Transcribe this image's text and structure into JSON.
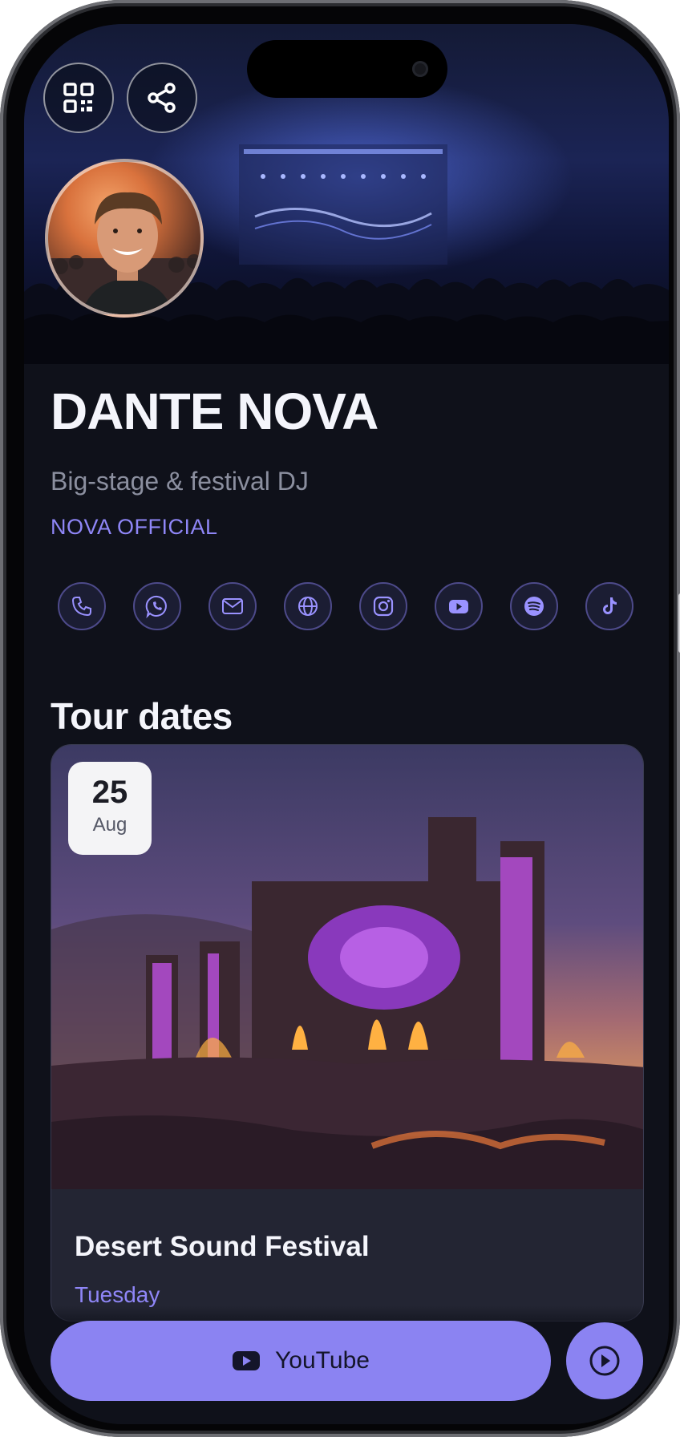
{
  "profile": {
    "name": "DANTE NOVA",
    "tagline": "Big-stage & festival DJ",
    "brand": "NOVA OFFICIAL"
  },
  "header": {
    "qr_icon": "qr-code-icon",
    "share_icon": "share-icon"
  },
  "socials": [
    "phone-icon",
    "whatsapp-icon",
    "mail-icon",
    "globe-icon",
    "instagram-icon",
    "youtube-icon",
    "spotify-icon",
    "tiktok-icon"
  ],
  "tour": {
    "title": "Tour dates",
    "events": [
      {
        "day": "25",
        "month": "Aug",
        "name": "Desert Sound Festival",
        "weekday": "Tuesday"
      }
    ]
  },
  "actions": {
    "primary_label": "YouTube",
    "primary_icon": "youtube-icon",
    "secondary_icon": "play-icon"
  },
  "colors": {
    "accent": "#8b83f2",
    "background": "#0f111a",
    "text": "#f4f5fb",
    "muted": "#8b8f9f"
  }
}
